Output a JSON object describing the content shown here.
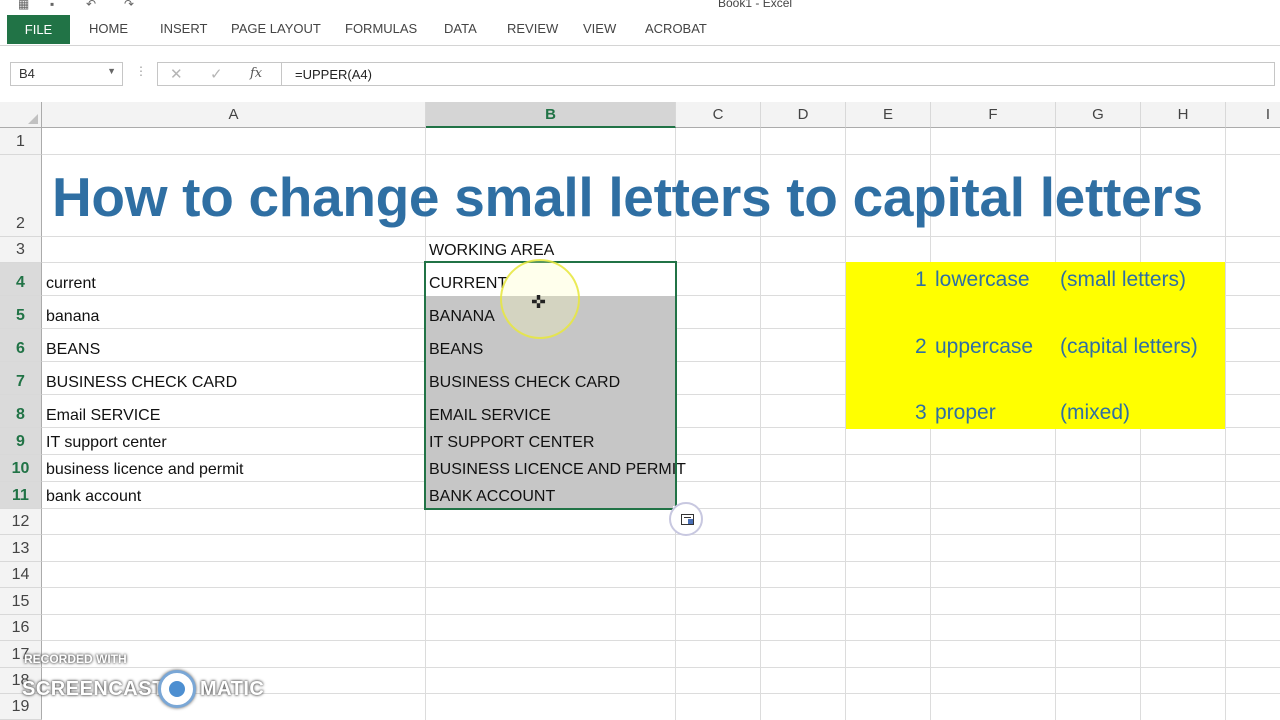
{
  "window": {
    "title": "Book1 - Excel"
  },
  "ribbon": {
    "tabs": [
      "FILE",
      "HOME",
      "INSERT",
      "PAGE LAYOUT",
      "FORMULAS",
      "DATA",
      "REVIEW",
      "VIEW",
      "ACROBAT"
    ]
  },
  "formula_bar": {
    "name_box": "B4",
    "formula": "=UPPER(A4)",
    "cancel_icon": "cancel-x-icon",
    "enter_icon": "check-icon",
    "fx_label": "fx"
  },
  "columns": [
    "A",
    "B",
    "C",
    "D",
    "E",
    "F",
    "G",
    "H",
    "I"
  ],
  "selected_column": "B",
  "rows": [
    "1",
    "2",
    "3",
    "4",
    "5",
    "6",
    "7",
    "8",
    "9",
    "10",
    "11",
    "12",
    "13",
    "14",
    "15",
    "16",
    "17",
    "18",
    "19"
  ],
  "selected_rows": [
    "4",
    "5",
    "6",
    "7",
    "8",
    "9",
    "10",
    "11"
  ],
  "sheet": {
    "title": "How to change small letters to capital letters",
    "working_area_label": "WORKING AREA",
    "column_a": [
      "current",
      "banana",
      "BEANS",
      "BUSINESS CHECK CARD",
      "Email SERVICE",
      "IT support center",
      "business licence and permit",
      "bank account"
    ],
    "column_b": [
      "CURRENT",
      "BANANA",
      "BEANS",
      "BUSINESS CHECK CARD",
      "EMAIL SERVICE",
      "IT SUPPORT CENTER",
      "BUSINESS LICENCE AND PERMIT",
      "BANK ACCOUNT"
    ],
    "legend": [
      {
        "num": "1",
        "name": "lowercase",
        "desc": "(small letters)"
      },
      {
        "num": "2",
        "name": "uppercase",
        "desc": "(capital letters)"
      },
      {
        "num": "3",
        "name": "proper",
        "desc": "(mixed)"
      }
    ]
  },
  "colors": {
    "excel_green": "#217346",
    "title_blue": "#2f6fa3",
    "highlight_yellow": "#ffff00",
    "selection_gray": "#c6c6c6"
  },
  "watermark": {
    "line1": "RECORDED WITH",
    "line2a": "SCREENCAST",
    "line2b": "MATIC"
  }
}
